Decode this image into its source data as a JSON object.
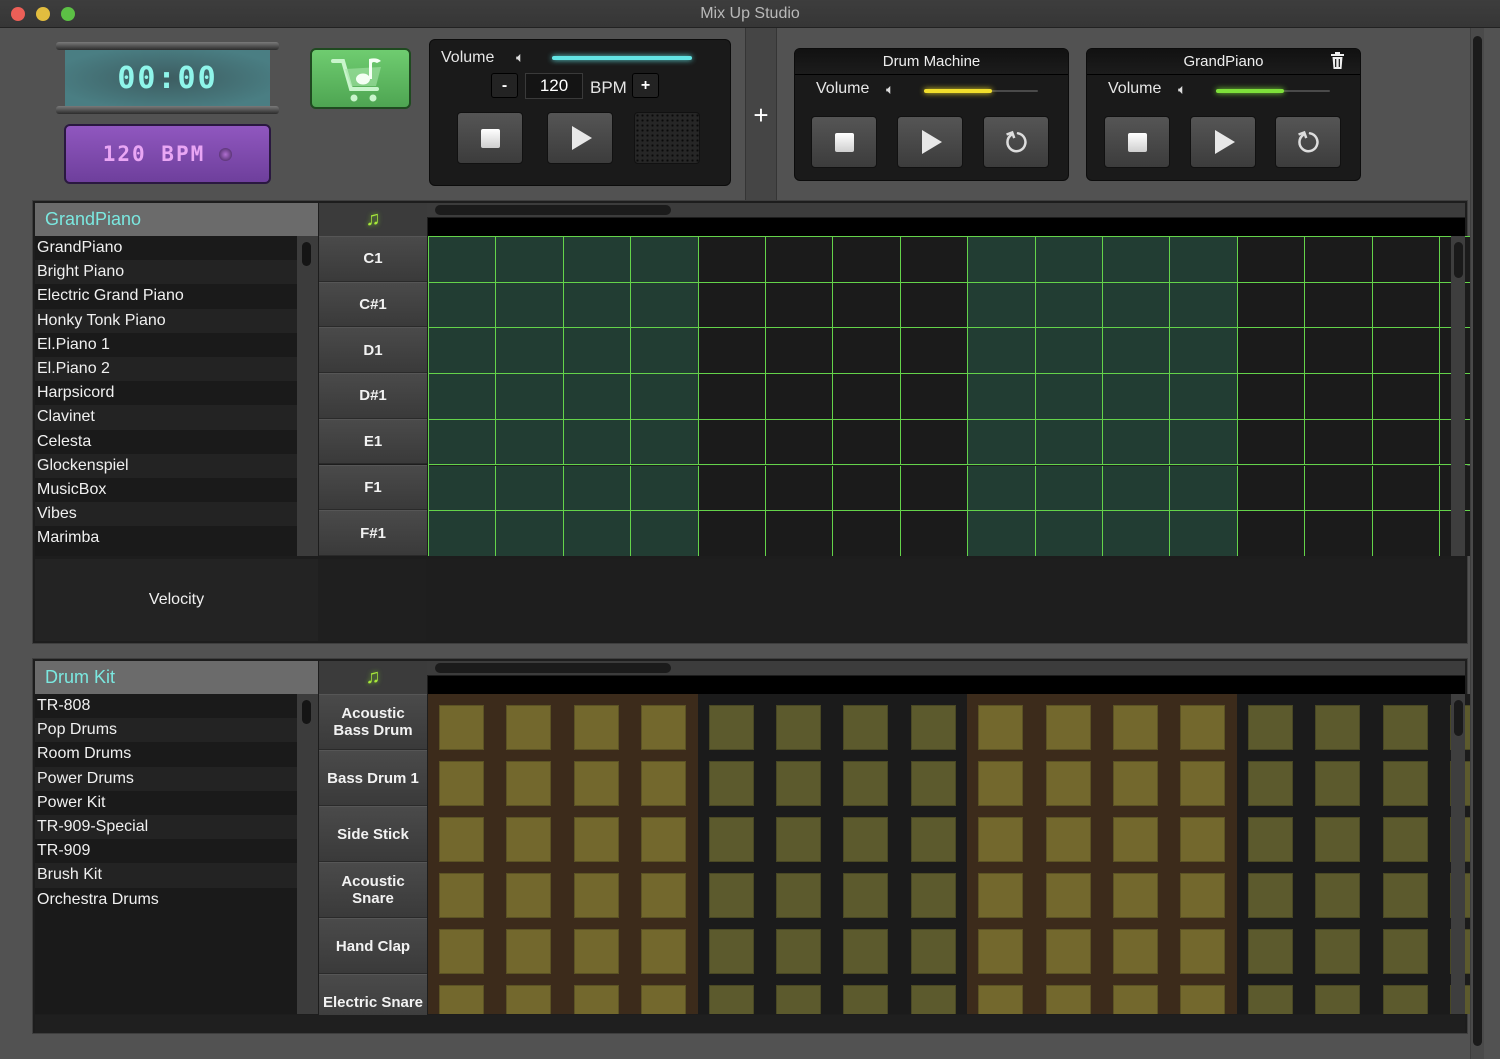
{
  "window": {
    "title": "Mix Up Studio",
    "controls": [
      "close",
      "minimize",
      "maximize"
    ]
  },
  "display": {
    "time": "00:00",
    "bpm_label": "120 BPM",
    "store_icon": "music-cart-icon"
  },
  "transport": {
    "volume_label": "Volume",
    "volume_icon": "speaker-icon",
    "volume_level": 1.0,
    "volume_color": "#63e6e6",
    "bpm_value": "120",
    "bpm_unit": "BPM",
    "decrement_label": "-",
    "increment_label": "+",
    "stop_icon": "stop-icon",
    "play_icon": "play-icon"
  },
  "add_track_label": "+",
  "tracks": [
    {
      "name": "Drum Machine",
      "volume_label": "Volume",
      "volume_level": 0.6,
      "volume_color": "#f1de2c",
      "has_delete": false
    },
    {
      "name": "GrandPiano",
      "volume_label": "Volume",
      "volume_level": 0.6,
      "volume_color": "#7ee03a",
      "has_delete": true
    }
  ],
  "piano_section": {
    "header": "GrandPiano",
    "instruments": [
      "GrandPiano",
      "Bright Piano",
      "Electric Grand Piano",
      "Honky Tonk Piano",
      "El.Piano 1",
      "El.Piano 2",
      "Harpsicord",
      "Clavinet",
      "Celesta",
      "Glockenspiel",
      "MusicBox",
      "Vibes",
      "Marimba"
    ],
    "notes": [
      "C1",
      "C#1",
      "D1",
      "D#1",
      "E1",
      "F1",
      "F#1"
    ],
    "velocity_label": "Velocity",
    "grid_color": "#64d34a",
    "beat_colors": [
      "#223d33",
      "#1b1b1b"
    ],
    "columns_visible": 16
  },
  "drum_section": {
    "header": "Drum Kit",
    "kits": [
      "TR-808",
      "Pop Drums",
      "Room Drums",
      "Power Drums",
      "Power Kit",
      "TR-909-Special",
      "TR-909",
      "Brush Kit",
      "Orchestra Drums"
    ],
    "sounds": [
      "Acoustic\nBass Drum",
      "Bass Drum 1",
      "Side Stick",
      "Acoustic\nSnare",
      "Hand Clap",
      "Electric Snare"
    ],
    "pad_colors": [
      "#73682d",
      "#5c5a2d"
    ],
    "beat_bg_colors": [
      "#3c2b1b",
      "#1b1b1b"
    ],
    "columns_visible": 15
  }
}
